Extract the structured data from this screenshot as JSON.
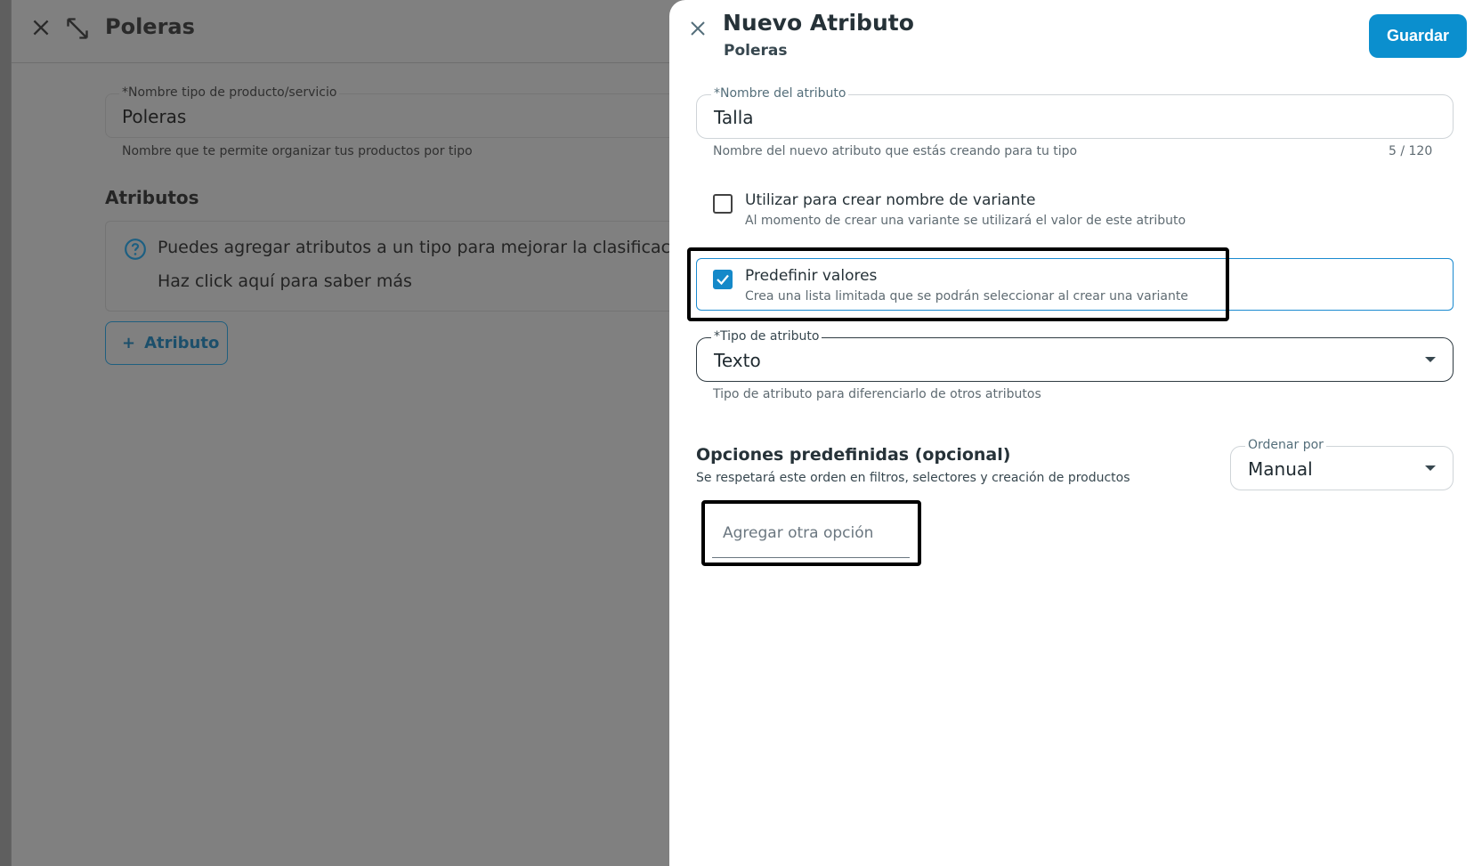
{
  "background": {
    "title": "Poleras",
    "name_field": {
      "label": "*Nombre tipo de producto/servicio",
      "value": "Poleras",
      "helper": "Nombre que te permite organizar tus productos por tipo"
    },
    "attributes_section": {
      "title": "Atributos",
      "info_text": "Puedes agregar atributos a un tipo para mejorar la clasificació",
      "info_link": "Haz click aquí para saber más",
      "add_button_label": "Atributo"
    }
  },
  "drawer": {
    "title": "Nuevo Atributo",
    "subtitle": "Poleras",
    "save_label": "Guardar",
    "name_field": {
      "label": "*Nombre del atributo",
      "value": "Talla",
      "helper": "Nombre del nuevo atributo que estás creando para tu tipo",
      "counter": "5 / 120"
    },
    "variant_name_checkbox": {
      "title": "Utilizar para crear nombre de variante",
      "description": "Al momento de crear una variante se utilizará el valor de este atributo",
      "checked": false
    },
    "predefine_checkbox": {
      "title": "Predefinir valores",
      "description": "Crea una lista limitada que se podrán seleccionar al crear una variante",
      "checked": true
    },
    "type_select": {
      "label": "*Tipo de atributo",
      "value": "Texto",
      "helper": "Tipo de atributo para diferenciarlo de otros atributos"
    },
    "options_section": {
      "title": "Opciones predefinidas (opcional)",
      "description": "Se respetará este orden en filtros, selectores y creación de productos",
      "sort_select": {
        "label": "Ordenar por",
        "value": "Manual"
      },
      "add_option_placeholder": "Agregar otra opción"
    }
  },
  "colors": {
    "primary": "#0b8fce",
    "text_dark": "#263238",
    "overlay": "#808080"
  }
}
